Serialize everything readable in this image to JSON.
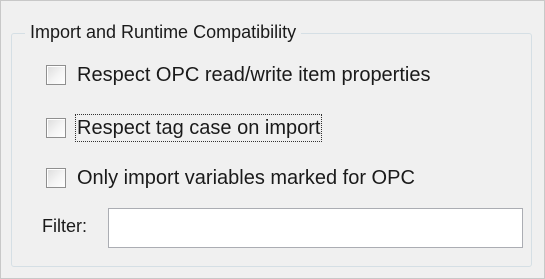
{
  "group": {
    "title": "Import and Runtime Compatibility"
  },
  "options": [
    {
      "label": "Respect OPC read/write item properties",
      "checked": false
    },
    {
      "label": "Respect tag case on import",
      "checked": false,
      "focused": true
    },
    {
      "label": "Only import variables marked for OPC",
      "checked": false
    }
  ],
  "filter": {
    "label": "Filter:",
    "value": "",
    "placeholder": ""
  },
  "colors": {
    "panel_background": "#f0f0f0",
    "groupbox_border": "#d5dfe5",
    "input_border": "#abadb3"
  }
}
